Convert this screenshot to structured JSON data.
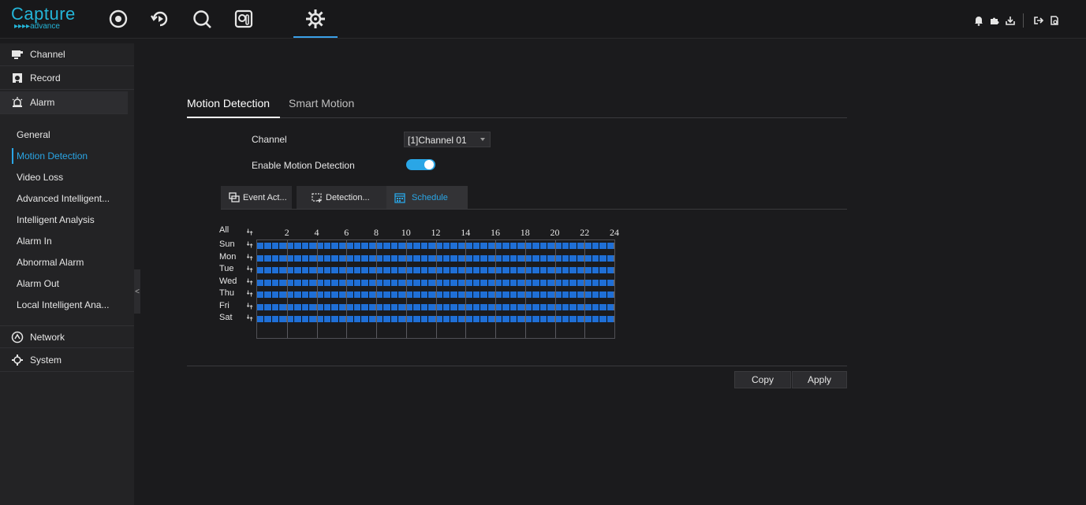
{
  "logo": {
    "line1": "Capture",
    "line2": "▸▸▸▸advance"
  },
  "top_nav": [
    {
      "id": "live",
      "icon": "live-view-icon"
    },
    {
      "id": "playback",
      "icon": "playback-icon"
    },
    {
      "id": "search",
      "icon": "search-icon"
    },
    {
      "id": "ai",
      "icon": "ai-analysis-icon"
    },
    {
      "id": "settings",
      "icon": "gear-icon",
      "active": true
    }
  ],
  "top_right": [
    "alarm-bell-icon",
    "puzzle-icon",
    "download-icon",
    "logout-icon",
    "info-icon"
  ],
  "sidebar": {
    "groups": [
      {
        "label": "Channel",
        "icon": "channel-icon"
      },
      {
        "label": "Record",
        "icon": "record-icon"
      },
      {
        "label": "Alarm",
        "icon": "alarm-siren-icon"
      },
      {
        "label": "Network",
        "icon": "network-icon"
      },
      {
        "label": "System",
        "icon": "system-icon"
      }
    ],
    "alarm_items": [
      {
        "label": "General"
      },
      {
        "label": "Motion Detection",
        "active": true
      },
      {
        "label": "Video Loss"
      },
      {
        "label": "Advanced Intelligent..."
      },
      {
        "label": "Intelligent Analysis"
      },
      {
        "label": "Alarm In"
      },
      {
        "label": "Abnormal Alarm"
      },
      {
        "label": "Alarm Out"
      },
      {
        "label": "Local Intelligent Ana..."
      }
    ],
    "collapse_glyph": "<"
  },
  "main_tabs": [
    {
      "label": "Motion Detection",
      "active": true
    },
    {
      "label": "Smart Motion"
    }
  ],
  "form": {
    "channel_label": "Channel",
    "channel_value": "[1]Channel 01",
    "enable_label": "Enable Motion Detection",
    "enable_on": true
  },
  "sub_tabs": [
    {
      "label": "Event Act...",
      "icon": "event-action-icon"
    },
    {
      "label": "Detection...",
      "icon": "detection-area-icon"
    },
    {
      "label": "Schedule",
      "icon": "calendar-icon",
      "active": true
    }
  ],
  "schedule": {
    "all_label": "All",
    "days": [
      "Sun",
      "Mon",
      "Tue",
      "Wed",
      "Thu",
      "Fri",
      "Sat"
    ],
    "hour_labels": [
      "2",
      "4",
      "6",
      "8",
      "10",
      "12",
      "14",
      "16",
      "18",
      "20",
      "22",
      "24"
    ],
    "fill_color": "#1f6fd6"
  },
  "buttons": {
    "copy": "Copy",
    "apply": "Apply"
  },
  "colors": {
    "accent": "#2aa6e6",
    "brand": "#24b5d8"
  }
}
